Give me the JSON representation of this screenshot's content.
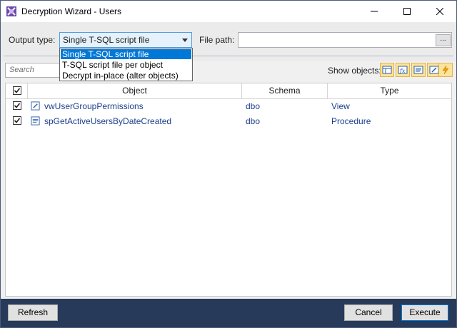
{
  "window": {
    "title": "Decryption Wizard - Users"
  },
  "toolbar": {
    "output_type_label": "Output type:",
    "output_type_value": "Single T-SQL script file",
    "file_path_label": "File path:",
    "file_path_value": "",
    "browse_label": "...",
    "search_placeholder": "Search",
    "show_objects_label": "Show objects:"
  },
  "dropdown": {
    "options": [
      "Single T-SQL script file",
      "T-SQL script file per object",
      "Decrypt in-place (alter objects)"
    ]
  },
  "grid": {
    "columns": [
      "Object",
      "Schema",
      "Type"
    ],
    "rows": [
      {
        "object": "vwUserGroupPermissions",
        "schema": "dbo",
        "type": "View",
        "icon": "view-icon",
        "checked": true
      },
      {
        "object": "spGetActiveUsersByDateCreated",
        "schema": "dbo",
        "type": "Procedure",
        "icon": "procedure-icon",
        "checked": true
      }
    ]
  },
  "footer": {
    "refresh_label": "Refresh",
    "cancel_label": "Cancel",
    "execute_label": "Execute"
  },
  "colors": {
    "footer": "#273a5a",
    "selection": "#0078d7",
    "link_text": "#1b3f8b",
    "filter_button": "#fde49a"
  }
}
